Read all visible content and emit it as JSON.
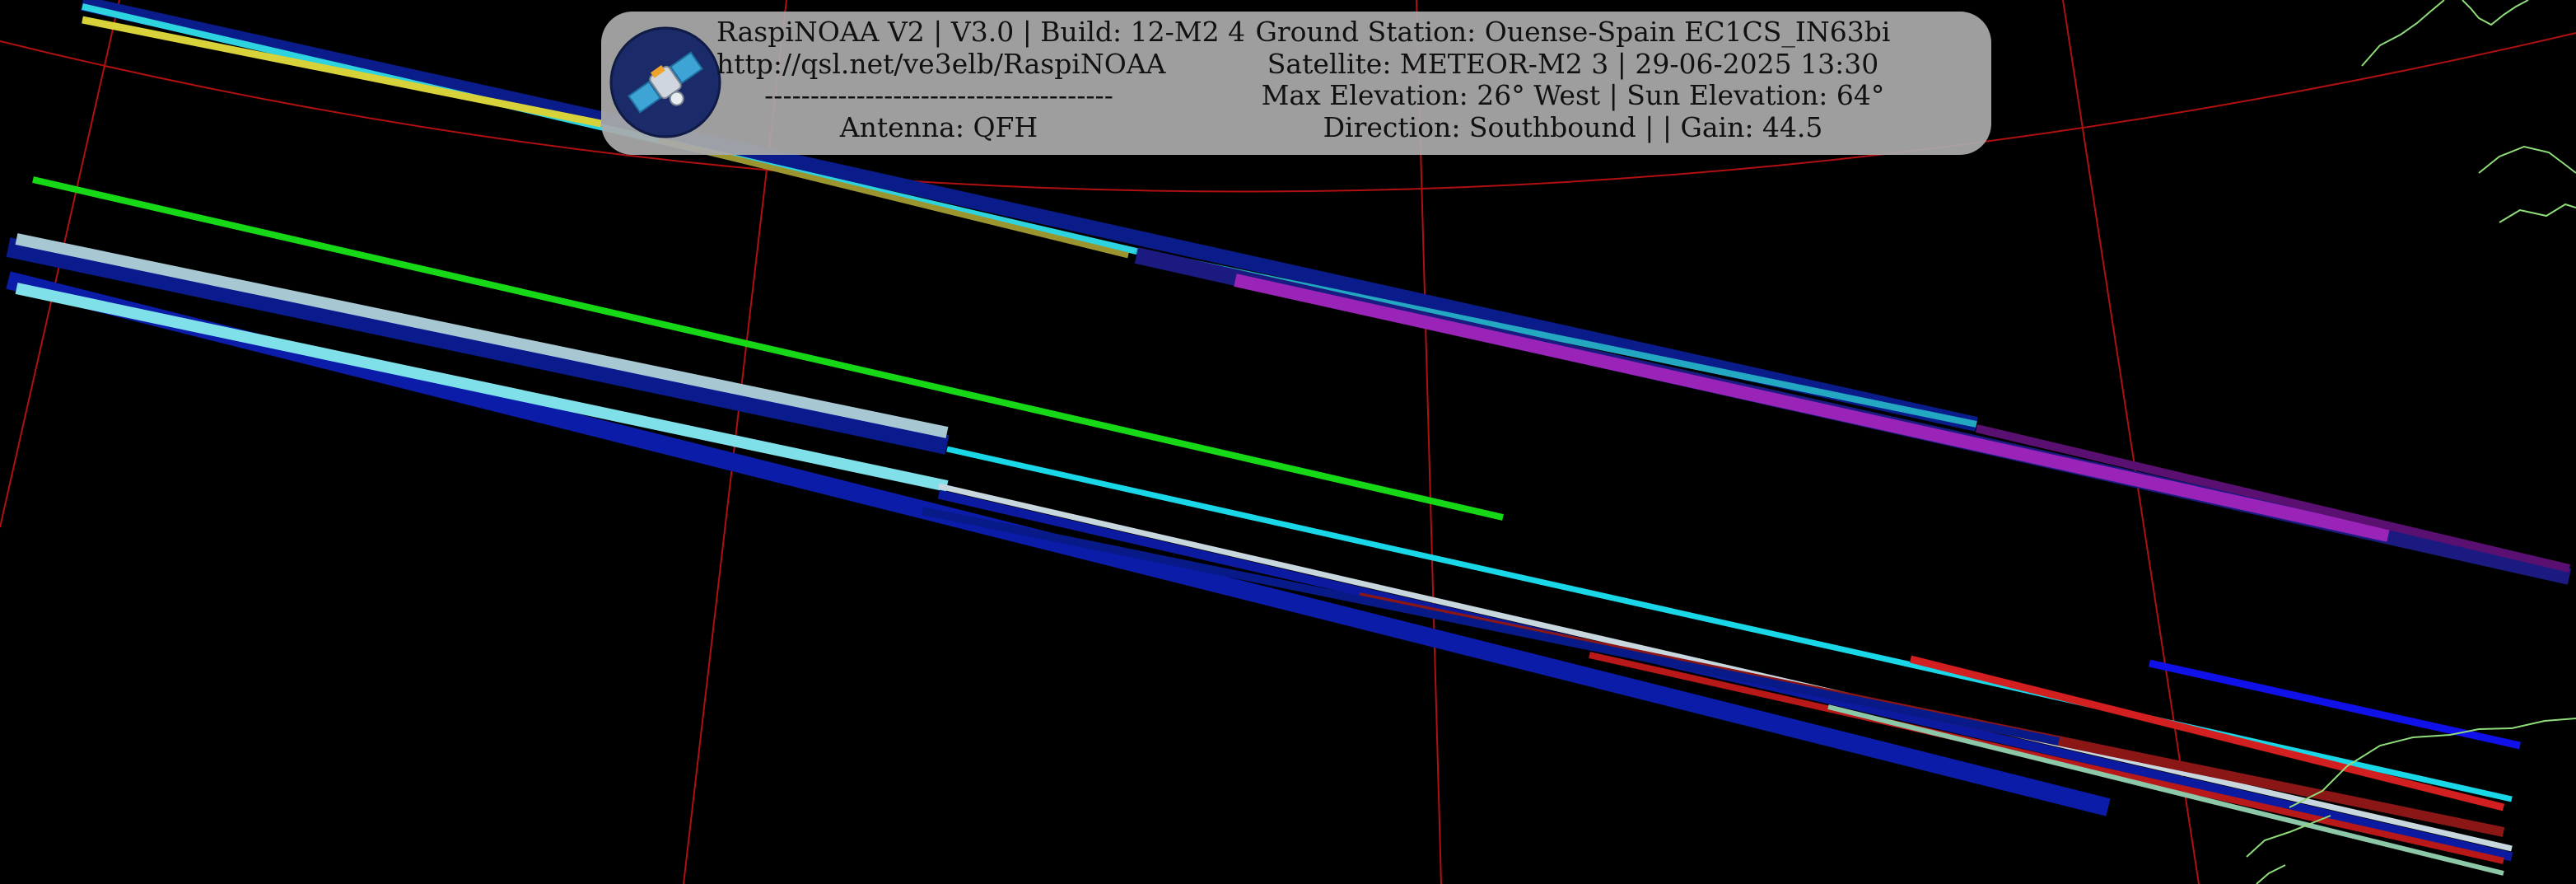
{
  "overlay": {
    "left_lines": [
      "RaspiNOAA V2 | V3.0 | Build: 12-M2 4",
      "http://qsl.net/ve3elb/RaspiNOAA",
      "--------------------------------------",
      "Antenna: QFH"
    ],
    "right_lines": [
      "Ground Station: Ouense-Spain EC1CS_IN63bi",
      "Satellite: METEOR-M2 3 | 29-06-2025 13:30",
      "Max Elevation: 26° West | Sun Elevation: 64°",
      "Direction: Southbound | | Gain: 44.5"
    ]
  },
  "colors": {
    "graticule": "#b01010",
    "coastline": "#8fdc7a",
    "overlay_bg": "#aaaaaa",
    "logo_bg": "#1b2a68"
  },
  "icons": {
    "logo": "satellite-icon"
  }
}
